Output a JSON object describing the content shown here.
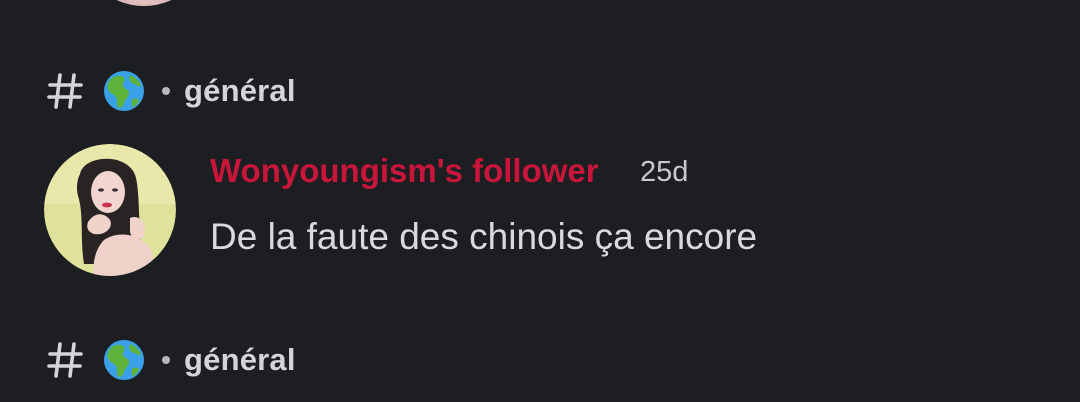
{
  "channels": [
    {
      "name": "général",
      "emoji": "globe-americas"
    },
    {
      "name": "général",
      "emoji": "globe-americas"
    }
  ],
  "message": {
    "author": "Wonyoungism's follower",
    "author_color": "#c8163a",
    "timestamp": "25d",
    "text": "De la faute des chinois ça encore"
  },
  "colors": {
    "background": "#1d1e22",
    "text": "#dcdde1",
    "muted": "#b7b9bf"
  }
}
